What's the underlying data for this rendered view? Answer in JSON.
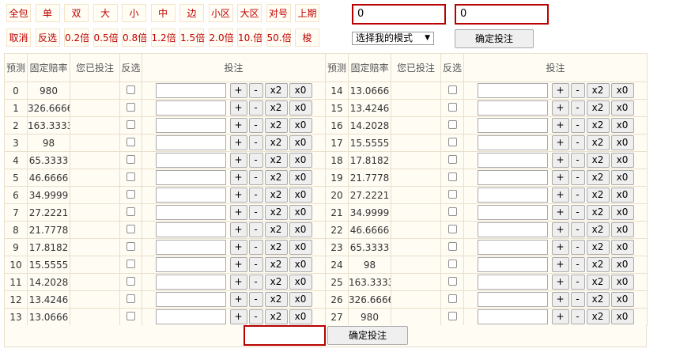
{
  "quick_buttons": {
    "row1": [
      "全包",
      "单",
      "双",
      "大",
      "小",
      "中",
      "边",
      "小区",
      "大区",
      "对号",
      "上期"
    ],
    "row2": [
      "取消",
      "反选",
      "0.2倍",
      "0.5倍",
      "0.8倍",
      "1.2倍",
      "1.5倍",
      "2.0倍",
      "10.倍",
      "50.倍",
      "梭"
    ]
  },
  "top_inputs": {
    "left_value": "0",
    "right_value": "0"
  },
  "mode_select": {
    "selected": "选择我的模式"
  },
  "confirm_top_label": "确定投注",
  "table": {
    "headers": {
      "predict": "预测",
      "odds": "固定赔率",
      "placed": "您已投注",
      "reverse": "反选",
      "bet": "投注"
    },
    "bet_buttons": {
      "plus": "+",
      "minus": "-",
      "double": "x2",
      "zero": "x0"
    },
    "left_rows": [
      {
        "num": "0",
        "odds": "980"
      },
      {
        "num": "1",
        "odds": "326.6666"
      },
      {
        "num": "2",
        "odds": "163.3333"
      },
      {
        "num": "3",
        "odds": "98"
      },
      {
        "num": "4",
        "odds": "65.3333"
      },
      {
        "num": "5",
        "odds": "46.6666"
      },
      {
        "num": "6",
        "odds": "34.9999"
      },
      {
        "num": "7",
        "odds": "27.2221"
      },
      {
        "num": "8",
        "odds": "21.7778"
      },
      {
        "num": "9",
        "odds": "17.8182"
      },
      {
        "num": "10",
        "odds": "15.5555"
      },
      {
        "num": "11",
        "odds": "14.2028"
      },
      {
        "num": "12",
        "odds": "13.4246"
      },
      {
        "num": "13",
        "odds": "13.0666"
      }
    ],
    "right_rows": [
      {
        "num": "14",
        "odds": "13.0666"
      },
      {
        "num": "15",
        "odds": "13.4246"
      },
      {
        "num": "16",
        "odds": "14.2028"
      },
      {
        "num": "17",
        "odds": "15.5555"
      },
      {
        "num": "18",
        "odds": "17.8182"
      },
      {
        "num": "19",
        "odds": "21.7778"
      },
      {
        "num": "20",
        "odds": "27.2221"
      },
      {
        "num": "21",
        "odds": "34.9999"
      },
      {
        "num": "22",
        "odds": "46.6666"
      },
      {
        "num": "23",
        "odds": "65.3333"
      },
      {
        "num": "24",
        "odds": "98"
      },
      {
        "num": "25",
        "odds": "163.3333"
      },
      {
        "num": "26",
        "odds": "326.6666"
      },
      {
        "num": "27",
        "odds": "980"
      }
    ]
  },
  "bottom": {
    "total_value": "",
    "confirm_label": "确定投注"
  },
  "colors": {
    "accent_red": "#c00000",
    "table_bg": "#fffcf4",
    "border": "#e9dfcc"
  }
}
